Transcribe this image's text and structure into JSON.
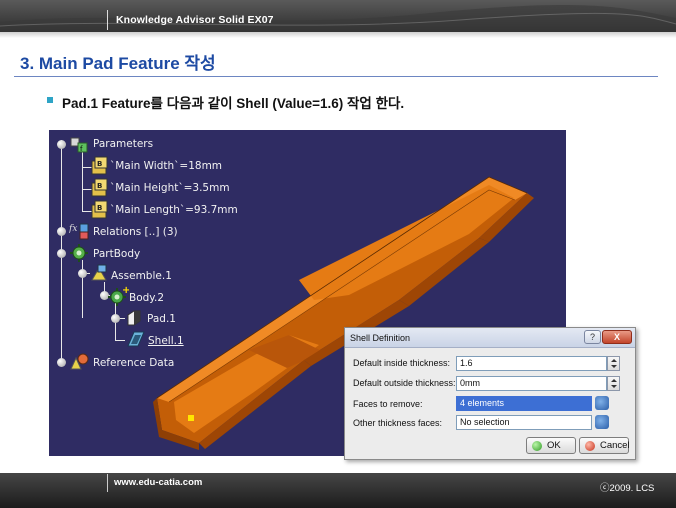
{
  "header": {
    "course_title": "Knowledge Advisor Solid EX07"
  },
  "slide": {
    "title": "3. Main Pad Feature 작성",
    "bullet": "Pad.1 Feature를 다음과 같이 Shell (Value=1.6) 작업 한다."
  },
  "spec_tree": {
    "parameters": "Parameters",
    "params": [
      "`Main Width`=18mm",
      "`Main Height`=3.5mm",
      "`Main Length`=93.7mm"
    ],
    "relations": "Relations [..] (3)",
    "part_body": "PartBody",
    "assemble": "Assemble.1",
    "body": "Body.2",
    "pad": "Pad.1",
    "shell": "Shell.1",
    "reference": "Reference Data"
  },
  "dialog": {
    "title": "Shell Definition",
    "help_label": "?",
    "close_label": "X",
    "inside_label": "Default inside thickness:",
    "inside_value": "1.6",
    "outside_label": "Default outside thickness:",
    "outside_value": "0mm",
    "faces_label": "Faces to remove:",
    "faces_value": "4 elements",
    "other_label": "Other thickness faces:",
    "other_value": "No selection",
    "ok_label": "OK",
    "cancel_label": "Cancel"
  },
  "footer": {
    "url": "www.edu-catia.com",
    "copyright": "ⓒ2009. LCS"
  },
  "colors": {
    "title_blue": "#1d4aa3",
    "viewport_bg": "#2f2c63",
    "part_orange": "#d9700f",
    "selection_blue": "#3d6fd4"
  }
}
